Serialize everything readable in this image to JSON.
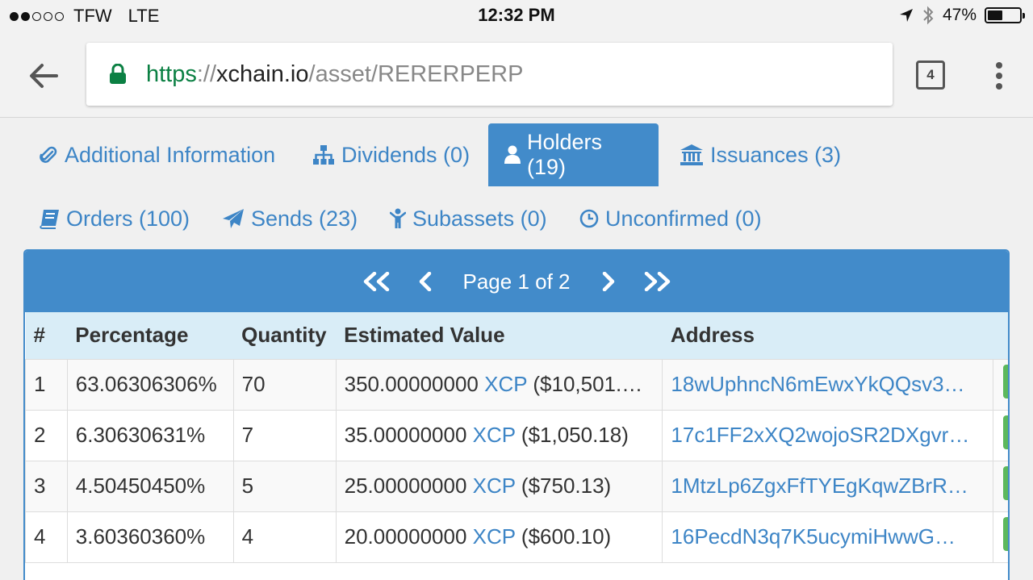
{
  "status_bar": {
    "carrier": "TFW",
    "network": "LTE",
    "time": "12:32 PM",
    "battery": "47%",
    "battery_level": 0.47,
    "signal_bars_filled": 2,
    "signal_bars_total": 5
  },
  "browser": {
    "url_scheme": "https",
    "url_separator": "://",
    "url_host": "xchain.io",
    "url_path": "/asset/RERERPERP",
    "tab_count": "4"
  },
  "tabs": [
    {
      "label": "Additional Information",
      "icon": "paperclip-icon"
    },
    {
      "label": "Dividends (0)",
      "icon": "sitemap-icon"
    },
    {
      "label": "Holders (19)",
      "icon": "user-icon",
      "active": true
    },
    {
      "label": "Issuances (3)",
      "icon": "bank-icon"
    },
    {
      "label": "Orders (100)",
      "icon": "book-icon"
    },
    {
      "label": "Sends (23)",
      "icon": "paper-plane-icon"
    },
    {
      "label": "Subassets (0)",
      "icon": "child-icon"
    },
    {
      "label": "Unconfirmed (0)",
      "icon": "clock-icon"
    }
  ],
  "pager": {
    "label": "Page 1 of 2"
  },
  "table": {
    "headers": [
      "#",
      "Percentage",
      "Quantity",
      "Estimated Value",
      "Address"
    ],
    "rows": [
      {
        "num": "1",
        "pct": "63.06306306%",
        "qty": "70",
        "amount": "350.00000000",
        "asset": "XCP",
        "usd": "($10,501.…",
        "address": "18wUphncN6mEwxYkQQsv3…",
        "action": "V"
      },
      {
        "num": "2",
        "pct": "6.30630631%",
        "qty": "7",
        "amount": "35.00000000",
        "asset": "XCP",
        "usd": "($1,050.18)",
        "address": "17c1FF2xXQ2wojoSR2DXgvr…",
        "action": "V"
      },
      {
        "num": "3",
        "pct": "4.50450450%",
        "qty": "5",
        "amount": "25.00000000",
        "asset": "XCP",
        "usd": "($750.13)",
        "address": "1MtzLp6ZgxFfTYEgKqwZBrR…",
        "action": "V"
      },
      {
        "num": "4",
        "pct": "3.60360360%",
        "qty": "4",
        "amount": "20.00000000",
        "asset": "XCP",
        "usd": "($600.10)",
        "address": "16PecdN3q7K5ucymiHwwG…",
        "action": "V"
      }
    ]
  },
  "colors": {
    "accent": "#428bca",
    "link": "#3d85c6",
    "header_row": "#d9edf7",
    "secure_scheme": "#0b8043",
    "view_button": "#5cb85c"
  }
}
